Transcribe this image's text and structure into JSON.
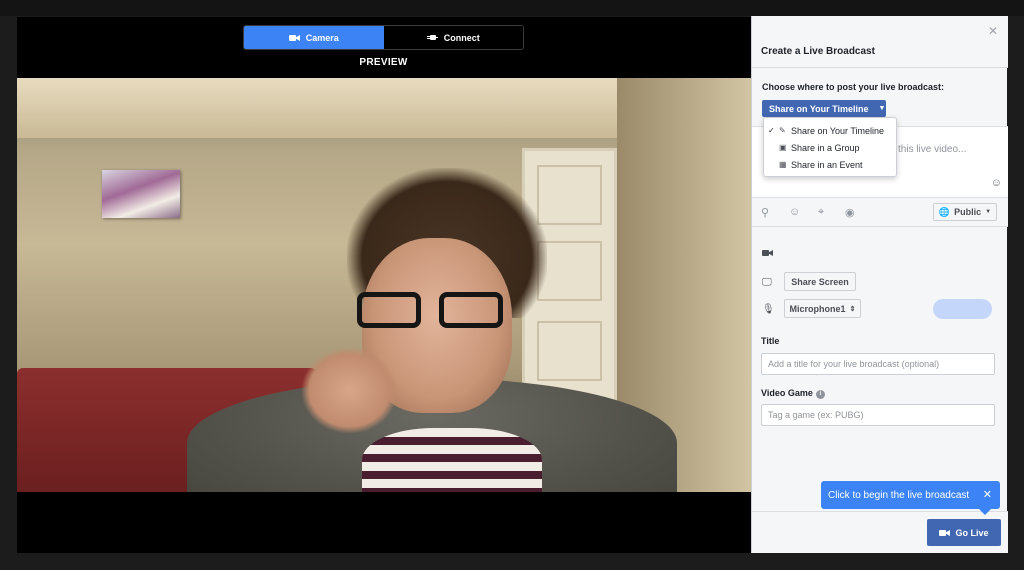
{
  "source_toggle": {
    "camera_label": "Camera",
    "connect_label": "Connect",
    "camera_icon": "video-camera-icon",
    "connect_icon": "plug-icon"
  },
  "preview_label": "PREVIEW",
  "panel": {
    "title": "Create a Live Broadcast",
    "close_icon": "close-icon",
    "choose_label": "Choose where to post your live broadcast:",
    "share_selected": "Share on Your Timeline",
    "share_options": [
      {
        "label": "Share on Your Timeline",
        "checked": true,
        "icon": "edit-icon"
      },
      {
        "label": "Share in a Group",
        "checked": false,
        "icon": "group-icon"
      },
      {
        "label": "Share in an Event",
        "checked": false,
        "icon": "calendar-icon"
      }
    ],
    "compose_placeholder": "this live video...",
    "privacy_label": "Public",
    "share_screen_label": "Share Screen",
    "microphone_value": "Microphone1",
    "title_label": "Title",
    "title_placeholder": "Add a title for your live broadcast (optional)",
    "game_label": "Video Game",
    "game_placeholder": "Tag a game (ex: PUBG)",
    "go_live_label": "Go Live"
  },
  "tooltip": {
    "text": "Click to begin the live broadcast"
  },
  "colors": {
    "accent_blue": "#3c84f6",
    "facebook_blue": "#4267b2",
    "panel_bg": "#f5f6f7"
  }
}
